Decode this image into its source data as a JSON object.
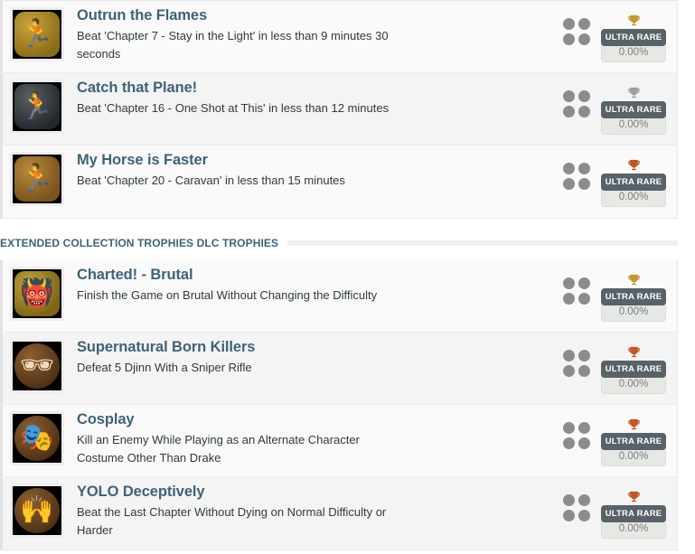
{
  "groups": [
    {
      "id": "base-trophies",
      "header": null,
      "rows": [
        {
          "title": "Outrun the Flames",
          "description": "Beat 'Chapter 7 - Stay in the Light' in less than 9 minutes 30 seconds",
          "icon_name": "runner-gold-medal-icon",
          "icon_glyph": "🏃",
          "medal_shape": "squarish",
          "medal_color": "#caa53a",
          "medal_color_2": "#8a6d18",
          "glyph_color": "#f6e6b0",
          "trophy_type": "gold",
          "trophy_color": "#c8962e",
          "rarity_label": "ULTRA RARE",
          "rarity_percent": "0.00%"
        },
        {
          "title": "Catch that Plane!",
          "description": "Beat 'Chapter 16 - One Shot at This' in less than 12 minutes",
          "icon_name": "runner-silver-medal-icon",
          "icon_glyph": "🏃",
          "medal_shape": "squarish",
          "medal_color": "#5c6166",
          "medal_color_2": "#23282c",
          "glyph_color": "#dfe6ea",
          "trophy_type": "silver",
          "trophy_color": "#9aa0a6",
          "rarity_label": "ULTRA RARE",
          "rarity_percent": "0.00%"
        },
        {
          "title": "My Horse is Faster",
          "description": "Beat 'Chapter 20 - Caravan' in less than 15 minutes",
          "icon_name": "runner-bronze-medal-icon",
          "icon_glyph": "🏃",
          "medal_shape": "squarish",
          "medal_color": "#b88a3e",
          "medal_color_2": "#7a541a",
          "glyph_color": "#f0d2a8",
          "trophy_type": "bronze",
          "trophy_color": "#c4561f",
          "rarity_label": "ULTRA RARE",
          "rarity_percent": "0.00%"
        }
      ]
    },
    {
      "id": "dlc-trophies",
      "header": "EXTENDED COLLECTION TROPHIES DLC TROPHIES",
      "rows": [
        {
          "title": "Charted! - Brutal",
          "description": "Finish the Game on Brutal Without Changing the Difficulty",
          "icon_name": "demon-face-gold-medal-icon",
          "icon_glyph": "👹",
          "medal_shape": "squarish",
          "medal_color": "#c6a63c",
          "medal_color_2": "#7e6415",
          "glyph_color": "#efdca4",
          "trophy_type": "gold",
          "trophy_color": "#c8962e",
          "rarity_label": "ULTRA RARE",
          "rarity_percent": "0.00%"
        },
        {
          "title": "Supernatural Born Killers",
          "description": "Defeat 5 Djinn With a Sniper Rifle",
          "icon_name": "sunglasses-man-bronze-medal-icon",
          "icon_glyph": "🕶",
          "medal_shape": "round",
          "medal_color": "#8d5f2f",
          "medal_color_2": "#4e3116",
          "glyph_color": "#f2dcc0",
          "trophy_type": "bronze",
          "trophy_color": "#c4561f",
          "rarity_label": "ULTRA RARE",
          "rarity_percent": "0.00%"
        },
        {
          "title": "Cosplay",
          "description": "Kill an Enemy While Playing as an Alternate Character Costume Other Than Drake",
          "icon_name": "masks-bronze-medal-icon",
          "icon_glyph": "🎭",
          "medal_shape": "round",
          "medal_color": "#8d5f2f",
          "medal_color_2": "#4e3116",
          "glyph_color": "#f2dcc0",
          "trophy_type": "bronze",
          "trophy_color": "#c4561f",
          "rarity_label": "ULTRA RARE",
          "rarity_percent": "0.00%"
        },
        {
          "title": "YOLO Deceptively",
          "description": "Beat the Last Chapter Without Dying on Normal Difficulty or Harder",
          "icon_name": "raised-arms-bronze-medal-icon",
          "icon_glyph": "🙌",
          "medal_shape": "round",
          "medal_color": "#8d5f2f",
          "medal_color_2": "#4e3116",
          "glyph_color": "#f2dcc0",
          "trophy_type": "bronze",
          "trophy_color": "#c4561f",
          "rarity_label": "ULTRA RARE",
          "rarity_percent": "0.00%"
        }
      ]
    }
  ]
}
